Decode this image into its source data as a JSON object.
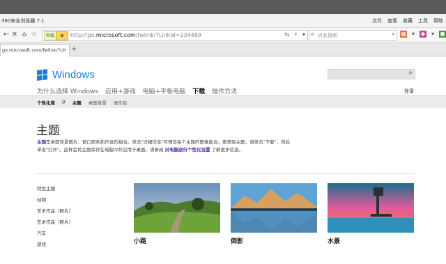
{
  "window": {
    "title": "360安全浏览器 7.1",
    "menu": [
      "文件",
      "查看",
      "收藏",
      "工具",
      "帮助"
    ]
  },
  "navbar": {
    "badge": "侧载",
    "url_prefix": "http://go.",
    "url_domain": "microsoft.com",
    "url_path": "/fwlink/?LinkId=234469",
    "search_placeholder": "点此搜索"
  },
  "tab": {
    "title": "go.microsoft.com/fwlink/?Li",
    "close": "×",
    "new": "+"
  },
  "site": {
    "brand": "Windows",
    "nav": [
      "为什么选择 Windows",
      "应用+游戏",
      "电脑+平板电脑",
      "下载",
      "操作方法"
    ],
    "nav_current_index": 3,
    "login": "登录",
    "subnav": [
      "个性化库",
      "//",
      "主题",
      "桌面背景",
      "语言包"
    ],
    "heading": "主题",
    "desc_link1": "主题",
    "desc_line1": "是桌面背景图片、窗口颜色和声音的组合。单击\"详细信息\"可预览每个主题的图像集合。要获取主题，请单击\"下载\"，然后",
    "desc_line2a": "单击\"打开\"。这样会将主题保存在电脑中并应用于桌面。请参阅",
    "desc_link2": "对电脑进行个性化设置",
    "desc_line2b": "了解更多信息。",
    "categories": [
      "特色主题",
      "动物",
      "艺术作品（照片）",
      "艺术作品（照片）",
      "汽车",
      "游戏"
    ],
    "themes": [
      {
        "name": "小路"
      },
      {
        "name": "倒影"
      },
      {
        "name": "水景"
      }
    ]
  },
  "colors": {
    "accent": "#1e7ad8",
    "link": "#5a2ca0"
  }
}
